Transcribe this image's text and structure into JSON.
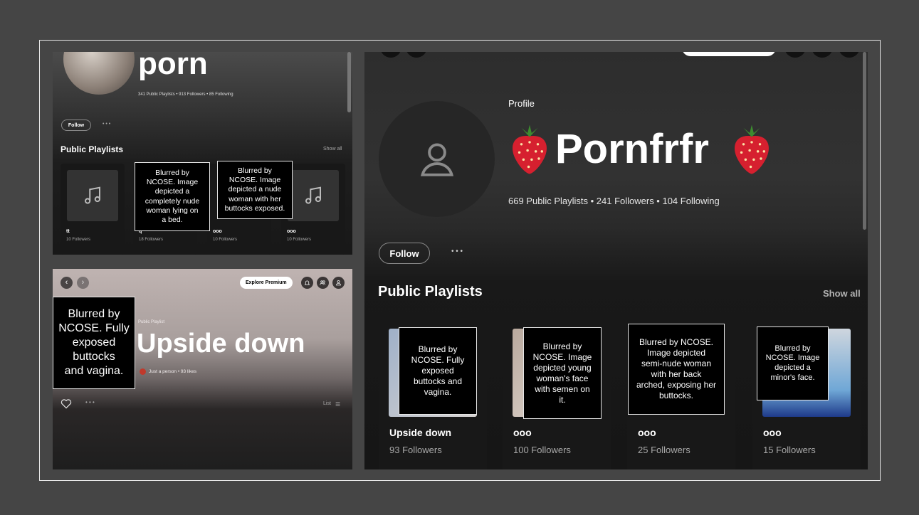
{
  "top_left": {
    "profile_name": "porn",
    "stats": "341 Public Playlists • 913 Followers • 85 Following",
    "follow_label": "Follow",
    "more_label": "• • •",
    "section_title": "Public Playlists",
    "show_all": "Show all",
    "cards": [
      {
        "title": "tt",
        "subtitle": "10 Followers"
      },
      {
        "title": "q",
        "subtitle": "18 Followers"
      },
      {
        "title": "ooo",
        "subtitle": "10 Followers"
      },
      {
        "title": "ooo",
        "subtitle": "10 Followers"
      }
    ],
    "blur_notes": [
      "Blurred by\nNCOSE. Image\ndepicted a\ncompletely nude\nwoman lying on\na bed.",
      "Blurred by\nNCOSE. Image\ndepicted a nude\nwoman with her\nbuttocks exposed."
    ]
  },
  "bottom_left": {
    "explore_premium": "Explore Premium",
    "kind_label": "Public Playlist",
    "title": "Upside down",
    "meta": "Just a person • 93 likes",
    "list_label": "List",
    "blur_note": "Blurred by\nNCOSE. Fully\nexposed\nbuttocks\nand vagina."
  },
  "right": {
    "kind_label": "Profile",
    "profile_name": "Pornfrfr",
    "stats": "669 Public Playlists • 241 Followers • 104 Following",
    "follow_label": "Follow",
    "more_label": "• • •",
    "section_title": "Public Playlists",
    "show_all": "Show all",
    "cards": [
      {
        "title": "Upside down",
        "subtitle": "93 Followers"
      },
      {
        "title": "ooo",
        "subtitle": "100 Followers"
      },
      {
        "title": "ooo",
        "subtitle": "25 Followers"
      },
      {
        "title": "ooo",
        "subtitle": "15 Followers"
      }
    ],
    "blur_notes": [
      "Blurred by\nNCOSE. Fully\nexposed\nbuttocks and\nvagina.",
      "Blurred by\nNCOSE. Image\ndepicted young\nwoman's face\nwith semen on\nit.",
      "Blurred by NCOSE.\nImage depicted\nsemi-nude woman\nwith her back\narched, exposing her\nbuttocks.",
      "Blurred by\nNCOSE. Image\ndepicted a\nminor's face."
    ]
  },
  "icons": {
    "music_note": "music-note-icon",
    "user": "user-icon",
    "strawberry": "strawberry-icon",
    "heart": "heart-icon",
    "bell": "bell-icon",
    "friends": "friends-icon",
    "back": "back-arrow-icon",
    "forward": "forward-arrow-icon",
    "list": "list-icon"
  },
  "colors": {
    "background": "#454545",
    "card": "#181818",
    "strawberry": "#d6202f"
  }
}
